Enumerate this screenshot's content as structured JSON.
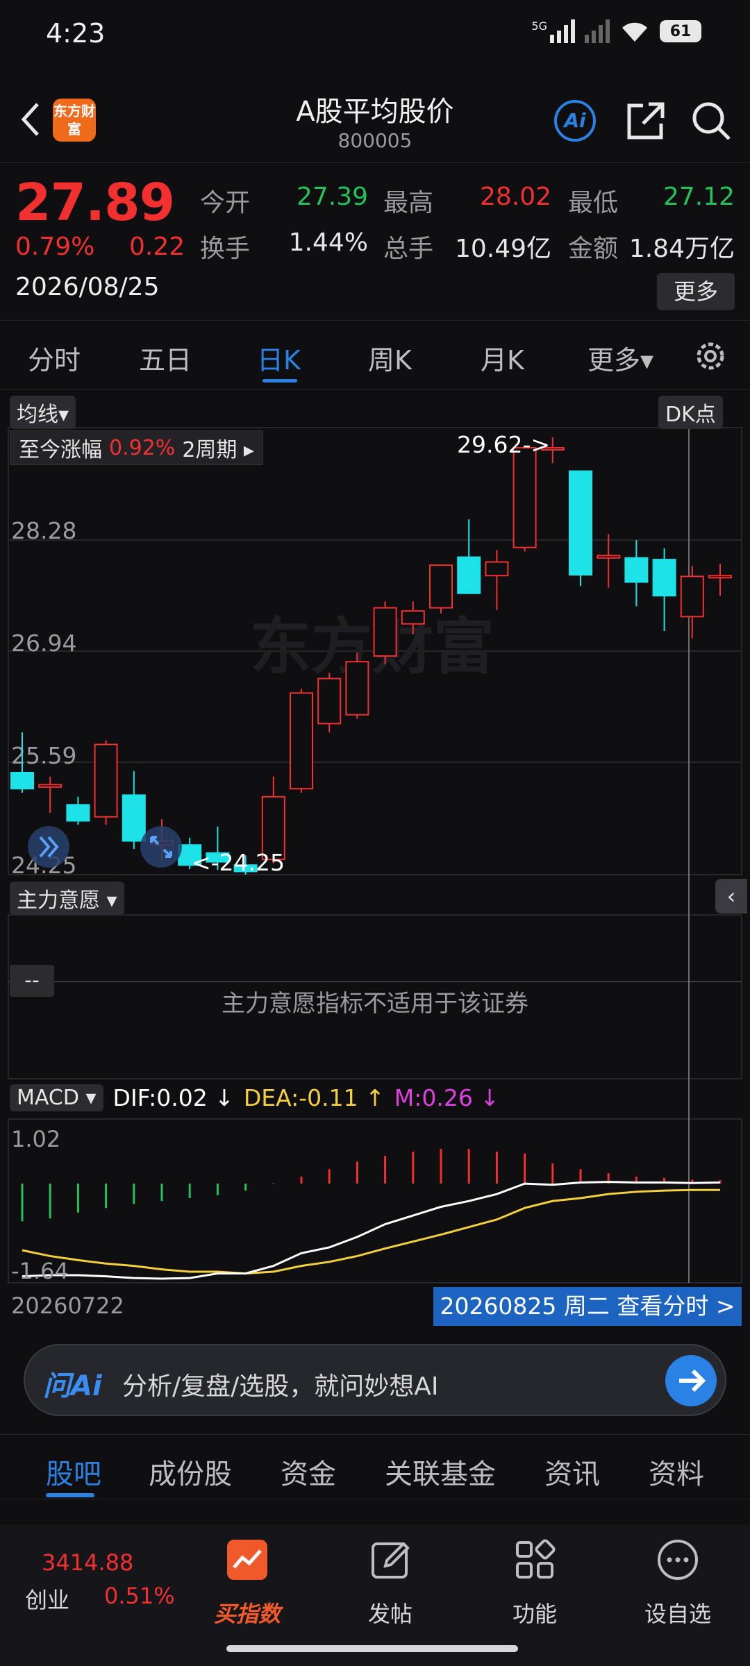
{
  "status_bar": {
    "time": "4:23",
    "network": "5G",
    "battery": "61"
  },
  "header": {
    "title": "A股平均股价",
    "code": "800005",
    "logo_text": "东方财富",
    "ai_label": "Ai"
  },
  "quote": {
    "price": "27.89",
    "change_pct": "0.79%",
    "change_amt": "0.22",
    "date": "2026/08/25",
    "open_label": "今开",
    "open": "27.39",
    "high_label": "最高",
    "high": "28.02",
    "low_label": "最低",
    "low": "27.12",
    "turnover_label": "换手",
    "turnover": "1.44%",
    "volume_label": "总手",
    "volume": "10.49亿",
    "amount_label": "金额",
    "amount": "1.84万亿",
    "more_label": "更多"
  },
  "period_tabs": [
    {
      "label": "分时",
      "active": false
    },
    {
      "label": "五日",
      "active": false
    },
    {
      "label": "日K",
      "active": true
    },
    {
      "label": "周K",
      "active": false
    },
    {
      "label": "月K",
      "active": false
    },
    {
      "label": "更多▾",
      "active": false
    }
  ],
  "chart": {
    "ma_selector": "均线▾",
    "dk_selector": "DK点",
    "since_label": "至今涨幅",
    "since_value": "0.92%",
    "since_period": "2周期 ▸",
    "watermark": "东方财富",
    "y_ticks": [
      "28.28",
      "26.94",
      "25.59",
      "24.25"
    ],
    "max_label": "29.62->",
    "min_label": "<-24.25",
    "zhuli_selector": "主力意愿 ▾",
    "zhuli_message": "主力意愿指标不适用于该证券",
    "zhuli_dash": "--",
    "macd_selector": "MACD ▾",
    "dif_text": "DIF:0.02 ↓",
    "dea_text": "DEA:-0.11 ↑",
    "m_text": "M:0.26 ↓",
    "macd_top": "1.02",
    "macd_bottom": "-1.64",
    "x_start": "20260722",
    "intraday_button": "20260825 周二 查看分时 >"
  },
  "chart_data": {
    "type": "candlestick",
    "y_range": [
      24.25,
      29.62
    ],
    "candles": [
      {
        "o": 25.45,
        "h": 25.95,
        "l": 25.2,
        "c": 25.25
      },
      {
        "o": 25.27,
        "h": 25.4,
        "l": 24.95,
        "c": 25.3
      },
      {
        "o": 25.05,
        "h": 25.15,
        "l": 24.8,
        "c": 24.85
      },
      {
        "o": 24.9,
        "h": 25.85,
        "l": 24.8,
        "c": 25.8
      },
      {
        "o": 25.17,
        "h": 25.47,
        "l": 24.5,
        "c": 24.6
      },
      {
        "o": 24.55,
        "h": 24.87,
        "l": 24.35,
        "c": 24.6
      },
      {
        "o": 24.55,
        "h": 24.64,
        "l": 24.25,
        "c": 24.3
      },
      {
        "o": 24.45,
        "h": 24.78,
        "l": 24.24,
        "c": 24.34
      },
      {
        "o": 24.3,
        "h": 24.42,
        "l": 24.18,
        "c": 24.22
      },
      {
        "o": 24.37,
        "h": 25.4,
        "l": 24.32,
        "c": 25.15
      },
      {
        "o": 25.25,
        "h": 26.49,
        "l": 25.2,
        "c": 26.44
      },
      {
        "o": 26.06,
        "h": 26.69,
        "l": 25.95,
        "c": 26.62
      },
      {
        "o": 26.17,
        "h": 26.94,
        "l": 26.12,
        "c": 26.83
      },
      {
        "o": 26.9,
        "h": 27.58,
        "l": 26.8,
        "c": 27.5
      },
      {
        "o": 27.3,
        "h": 27.58,
        "l": 27.17,
        "c": 27.46
      },
      {
        "o": 27.5,
        "h": 28.03,
        "l": 27.43,
        "c": 28.03
      },
      {
        "o": 28.13,
        "h": 28.6,
        "l": 27.68,
        "c": 27.68
      },
      {
        "o": 27.9,
        "h": 28.22,
        "l": 27.47,
        "c": 28.07
      },
      {
        "o": 28.25,
        "h": 29.49,
        "l": 28.2,
        "c": 29.49
      },
      {
        "o": 29.47,
        "h": 29.62,
        "l": 29.3,
        "c": 29.49
      },
      {
        "o": 29.2,
        "h": 29.2,
        "l": 27.77,
        "c": 27.91
      },
      {
        "o": 28.12,
        "h": 28.42,
        "l": 27.75,
        "c": 28.15
      },
      {
        "o": 28.12,
        "h": 28.34,
        "l": 27.52,
        "c": 27.82
      },
      {
        "o": 28.1,
        "h": 28.24,
        "l": 27.21,
        "c": 27.65
      },
      {
        "o": 27.39,
        "h": 28.02,
        "l": 27.12,
        "c": 27.89
      },
      {
        "o": 27.89,
        "h": 28.05,
        "l": 27.65,
        "c": 27.9
      }
    ],
    "macd": {
      "range": [
        -1.64,
        1.02
      ],
      "bars": [
        -0.65,
        -0.6,
        -0.5,
        -0.42,
        -0.35,
        -0.3,
        -0.25,
        -0.2,
        -0.12,
        -0.01,
        0.12,
        0.25,
        0.38,
        0.48,
        0.55,
        0.6,
        0.6,
        0.55,
        0.52,
        0.35,
        0.25,
        0.18,
        0.12,
        0.1,
        0.07,
        0.06
      ],
      "dif": [
        -1.6,
        -1.58,
        -1.58,
        -1.6,
        -1.63,
        -1.64,
        -1.63,
        -1.55,
        -1.55,
        -1.42,
        -1.2,
        -1.1,
        -0.92,
        -0.7,
        -0.55,
        -0.4,
        -0.3,
        -0.18,
        0.0,
        -0.02,
        0.02,
        0.03,
        0.02,
        0.02,
        0.01,
        0.02
      ],
      "dea": [
        -1.15,
        -1.25,
        -1.32,
        -1.38,
        -1.42,
        -1.48,
        -1.52,
        -1.52,
        -1.55,
        -1.52,
        -1.42,
        -1.35,
        -1.25,
        -1.12,
        -1.0,
        -0.88,
        -0.75,
        -0.62,
        -0.42,
        -0.3,
        -0.25,
        -0.18,
        -0.14,
        -0.12,
        -0.11,
        -0.11
      ]
    }
  },
  "ai_bar": {
    "label": "问Ai",
    "placeholder": "分析/复盘/选股，就问妙想AI"
  },
  "content_tabs": [
    {
      "label": "股吧",
      "active": true
    },
    {
      "label": "成份股",
      "active": false
    },
    {
      "label": "资金",
      "active": false
    },
    {
      "label": "关联基金",
      "active": false
    },
    {
      "label": "资讯",
      "active": false
    },
    {
      "label": "资料",
      "active": false
    }
  ],
  "bottom_nav": {
    "ticker_value": "3414.88",
    "ticker_name": "创业",
    "ticker_pct": "0.51%",
    "items": [
      {
        "label": "买指数",
        "icon": "trend-chart-icon",
        "active": true
      },
      {
        "label": "发帖",
        "icon": "edit-icon",
        "active": false
      },
      {
        "label": "功能",
        "icon": "grid-icon",
        "active": false
      },
      {
        "label": "设自选",
        "icon": "more-circle-icon",
        "active": false
      }
    ]
  },
  "colors": {
    "up": "#f23030",
    "down": "#1de3e8",
    "accent": "#2a82e4",
    "dea": "#f4d03f",
    "m": "#e040e0"
  }
}
